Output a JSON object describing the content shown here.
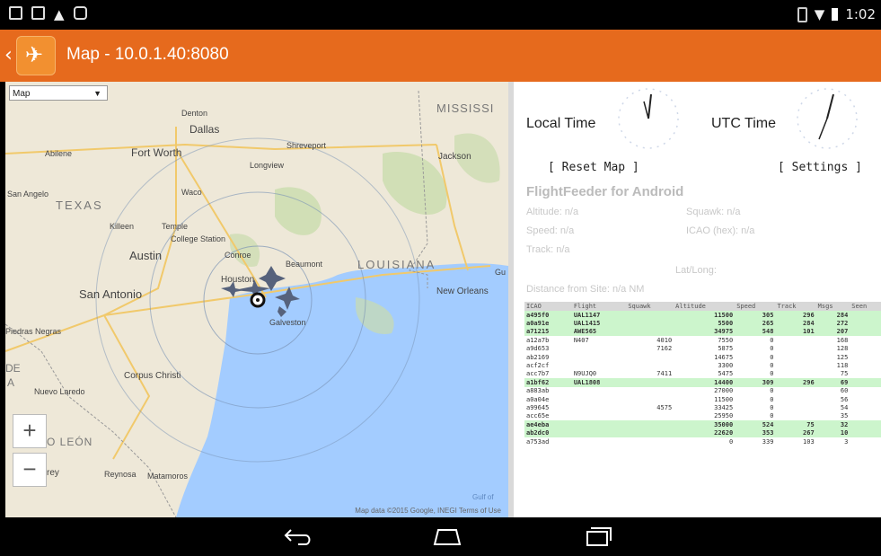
{
  "status_bar": {
    "time": "1:02",
    "icons": [
      "notification-icon",
      "gallery-icon",
      "warning-icon",
      "bag-icon"
    ],
    "right_icons": [
      "vibrate-icon",
      "wifi-icon",
      "battery-icon"
    ]
  },
  "action_bar": {
    "back": "‹",
    "title": "Map - 10.0.1.40:8080",
    "color": "#e66a1d"
  },
  "map": {
    "type_select": "Map",
    "zoom_in": "+",
    "zoom_out": "−",
    "attribution": "Map data ©2015 Google, INEGI   Terms of Use",
    "labels": {
      "mississippi": "MISSISSI",
      "denton": "Denton",
      "dallas": "Dallas",
      "shreveport": "Shreveport",
      "jackson": "Jackson",
      "abilene": "Abilene",
      "fort_worth": "Fort Worth",
      "longview": "Longview",
      "san_angelo": "San Angelo",
      "texas": "TEXAS",
      "waco": "Waco",
      "killeen": "Killeen",
      "temple": "Temple",
      "college_station": "College Station",
      "austin": "Austin",
      "conroe": "Conroe",
      "beaumont": "Beaumont",
      "louisiana": "LOUISIANA",
      "houston": "Houston",
      "new_orleans": "New Orleans",
      "san_antonio": "San Antonio",
      "galveston": "Galveston",
      "piedras_negras": "Piedras Negras",
      "de": "DE",
      "a": "A",
      "corpus_christi": "Corpus Christi",
      "nuevo_laredo": "Nuevo Laredo",
      "leon": "O LEÓN",
      "rey": "rey",
      "reynosa": "Reynosa",
      "matamoros": "Matamoros",
      "gulf": "Gulf of",
      "gu": "Gu"
    }
  },
  "panel": {
    "local_time_label": "Local Time",
    "utc_time_label": "UTC Time",
    "reset_map": "[ Reset Map ]",
    "settings": "[ Settings ]",
    "heading": "FlightFeeder for Android",
    "altitude": "Altitude: n/a",
    "squawk": "Squawk: n/a",
    "speed": "Speed: n/a",
    "icao": "ICAO (hex): n/a",
    "track": "Track: n/a",
    "latlong": "Lat/Long:",
    "distance": "Distance from Site: n/a NM",
    "table": {
      "headers": [
        "ICAO",
        "Flight",
        "Squawk",
        "Altitude",
        "Speed",
        "Track",
        "Msgs",
        "Seen"
      ],
      "rows": [
        {
          "hl": true,
          "c": [
            "a495f0",
            "UAL1147",
            "",
            "11500",
            "305",
            "296",
            "284",
            ""
          ]
        },
        {
          "hl": true,
          "c": [
            "a0a91e",
            "UAL1415",
            "",
            "5500",
            "265",
            "284",
            "272",
            ""
          ]
        },
        {
          "hl": true,
          "c": [
            "a71215",
            "AWE565",
            "",
            "34975",
            "548",
            "101",
            "207",
            ""
          ]
        },
        {
          "hl": false,
          "c": [
            "a12a7b",
            "N407",
            "4010",
            "7550",
            "0",
            "",
            "168",
            ""
          ]
        },
        {
          "hl": false,
          "c": [
            "a9d653",
            "",
            "7162",
            "5875",
            "0",
            "",
            "128",
            ""
          ]
        },
        {
          "hl": false,
          "c": [
            "ab2169",
            "",
            "",
            "14675",
            "0",
            "",
            "125",
            ""
          ]
        },
        {
          "hl": false,
          "c": [
            "acf2cf",
            "",
            "",
            "3300",
            "0",
            "",
            "118",
            ""
          ]
        },
        {
          "hl": false,
          "c": [
            "acc7b7",
            "N9UJQ0",
            "7411",
            "5475",
            "0",
            "",
            "75",
            ""
          ]
        },
        {
          "hl": true,
          "c": [
            "a1bf62",
            "UAL1808",
            "",
            "14400",
            "309",
            "296",
            "69",
            ""
          ]
        },
        {
          "hl": false,
          "c": [
            "a883ab",
            "",
            "",
            "27000",
            "0",
            "",
            "60",
            ""
          ]
        },
        {
          "hl": false,
          "c": [
            "a0a04e",
            "",
            "",
            "11500",
            "0",
            "",
            "56",
            ""
          ]
        },
        {
          "hl": false,
          "c": [
            "a99645",
            "",
            "4575",
            "33425",
            "0",
            "",
            "54",
            ""
          ]
        },
        {
          "hl": false,
          "c": [
            "acc65e",
            "",
            "",
            "25950",
            "0",
            "",
            "35",
            ""
          ]
        },
        {
          "hl": true,
          "c": [
            "ae4eba",
            "",
            "",
            "35000",
            "524",
            "75",
            "32",
            ""
          ]
        },
        {
          "hl": true,
          "c": [
            "ab2dc0",
            "",
            "",
            "22620",
            "353",
            "267",
            "10",
            ""
          ]
        },
        {
          "hl": false,
          "c": [
            "a753ad",
            "",
            "",
            "0",
            "339",
            "103",
            "3",
            ""
          ]
        }
      ]
    }
  },
  "nav_bar": {
    "back": "back-icon",
    "home": "home-icon",
    "recents": "recents-icon"
  }
}
